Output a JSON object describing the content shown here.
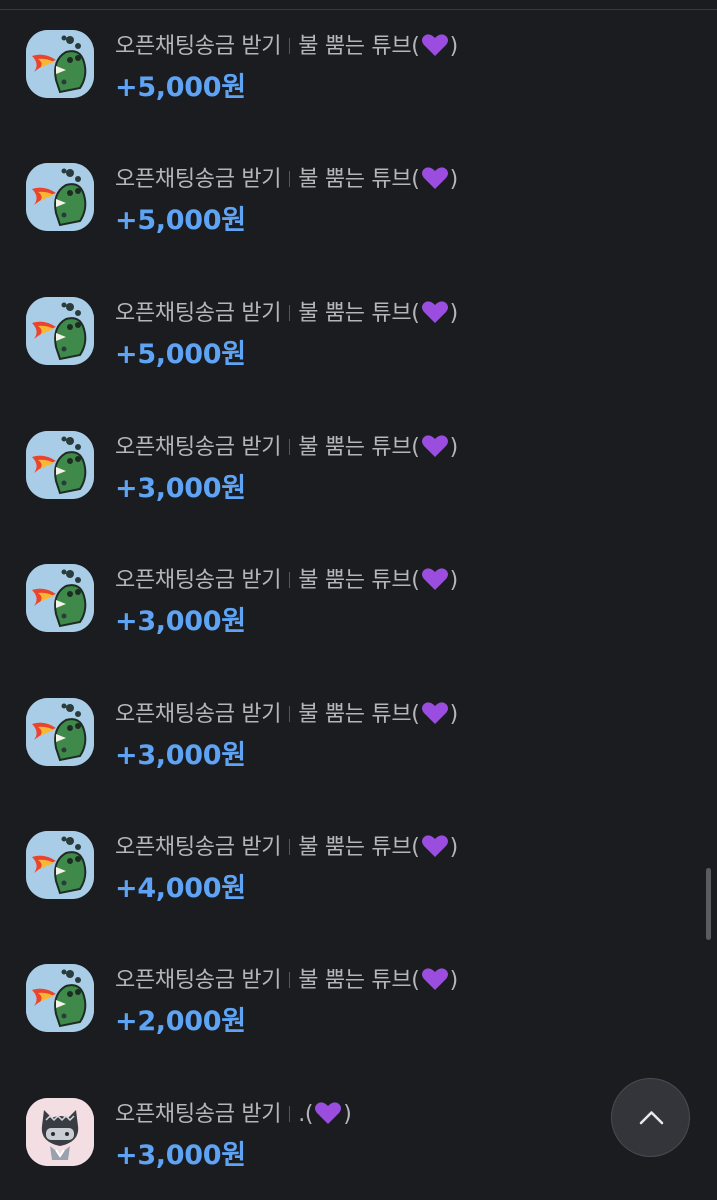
{
  "transactions": [
    {
      "type_label": "오픈채팅송금 받기",
      "sender": "불 뿜는 튜브(",
      "sender_tail": ")",
      "amount": "+5,000원",
      "avatar": "tube-fire-breathing-avatar-icon"
    },
    {
      "type_label": "오픈채팅송금 받기",
      "sender": "불 뿜는 튜브(",
      "sender_tail": ")",
      "amount": "+5,000원",
      "avatar": "tube-fire-breathing-avatar-icon"
    },
    {
      "type_label": "오픈채팅송금 받기",
      "sender": "불 뿜는 튜브(",
      "sender_tail": ")",
      "amount": "+5,000원",
      "avatar": "tube-fire-breathing-avatar-icon"
    },
    {
      "type_label": "오픈채팅송금 받기",
      "sender": "불 뿜는 튜브(",
      "sender_tail": ")",
      "amount": "+3,000원",
      "avatar": "tube-fire-breathing-avatar-icon"
    },
    {
      "type_label": "오픈채팅송금 받기",
      "sender": "불 뿜는 튜브(",
      "sender_tail": ")",
      "amount": "+3,000원",
      "avatar": "tube-fire-breathing-avatar-icon"
    },
    {
      "type_label": "오픈채팅송금 받기",
      "sender": "불 뿜는 튜브(",
      "sender_tail": ")",
      "amount": "+3,000원",
      "avatar": "tube-fire-breathing-avatar-icon"
    },
    {
      "type_label": "오픈채팅송금 받기",
      "sender": "불 뿜는 튜브(",
      "sender_tail": ")",
      "amount": "+4,000원",
      "avatar": "tube-fire-breathing-avatar-icon"
    },
    {
      "type_label": "오픈채팅송금 받기",
      "sender": "불 뿜는 튜브(",
      "sender_tail": ")",
      "amount": "+2,000원",
      "avatar": "tube-fire-breathing-avatar-icon"
    },
    {
      "type_label": "오픈채팅송금 받기",
      "sender": ".(",
      "sender_tail": ")",
      "amount": "+3,000원",
      "avatar": "cat-character-avatar-icon"
    }
  ],
  "scroll_top_button": {
    "icon": "chevron-up-icon"
  },
  "colors": {
    "background": "#1b1c20",
    "amount_text": "#5fa4f4",
    "label_text": "#b5b6bb",
    "heart": "#9b4de0"
  }
}
